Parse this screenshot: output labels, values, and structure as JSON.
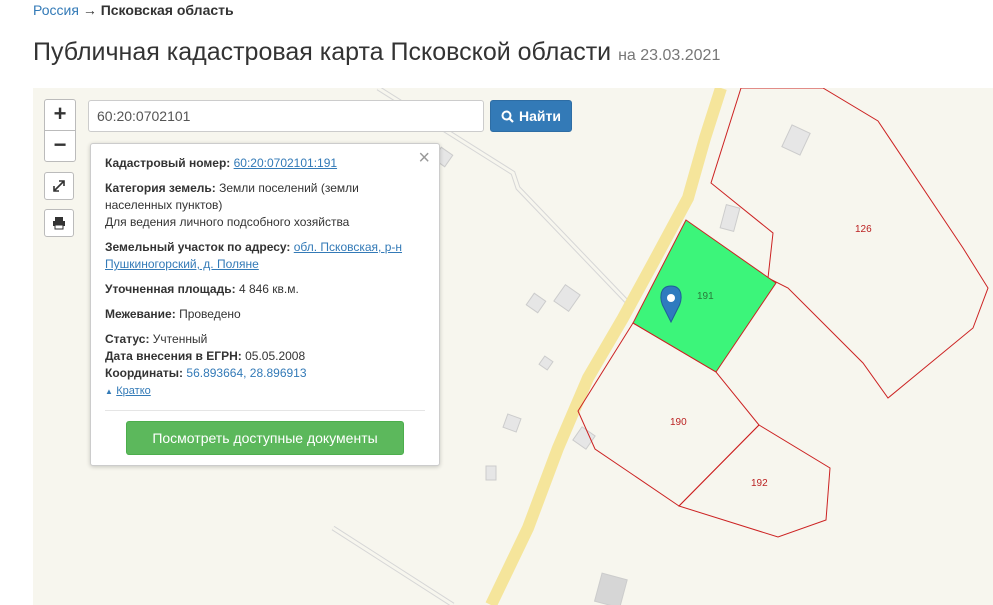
{
  "breadcrumb": {
    "root": "Россия",
    "arrow": "→",
    "current": "Псковская область"
  },
  "page": {
    "title": "Публичная кадастровая карта Псковской области",
    "date": "на 23.03.2021"
  },
  "map": {
    "zoom_in": "+",
    "zoom_out": "−",
    "search_value": "60:20:0702101",
    "find_label": "Найти",
    "parcel_labels": {
      "p191": "191",
      "p126": "126",
      "p190": "190",
      "p192": "192"
    },
    "selected_color": "#3cf57a",
    "border_color": "#cc2222"
  },
  "popup": {
    "close": "×",
    "cadastral_label": "Кадастровый номер:",
    "cadastral_value": "60:20:0702101:191",
    "category_label": "Категория земель:",
    "category_value": "Земли поселений (земли населенных пунктов)",
    "category_use": "Для ведения личного подсобного хозяйства",
    "address_label": "Земельный участок по адресу:",
    "address_value": "обл. Псковская, р-н Пушкиногорский, д. Поляне",
    "area_label": "Уточненная площадь:",
    "area_value": "4 846 кв.м.",
    "survey_label": "Межевание:",
    "survey_value": "Проведено",
    "status_label": "Статус:",
    "status_value": "Учтенный",
    "egrn_label": "Дата внесения в ЕГРН:",
    "egrn_value": "05.05.2008",
    "coords_label": "Координаты:",
    "coords_value": "56.893664, 28.896913",
    "brief_label": "Кратко",
    "docs_button": "Посмотреть доступные документы"
  }
}
